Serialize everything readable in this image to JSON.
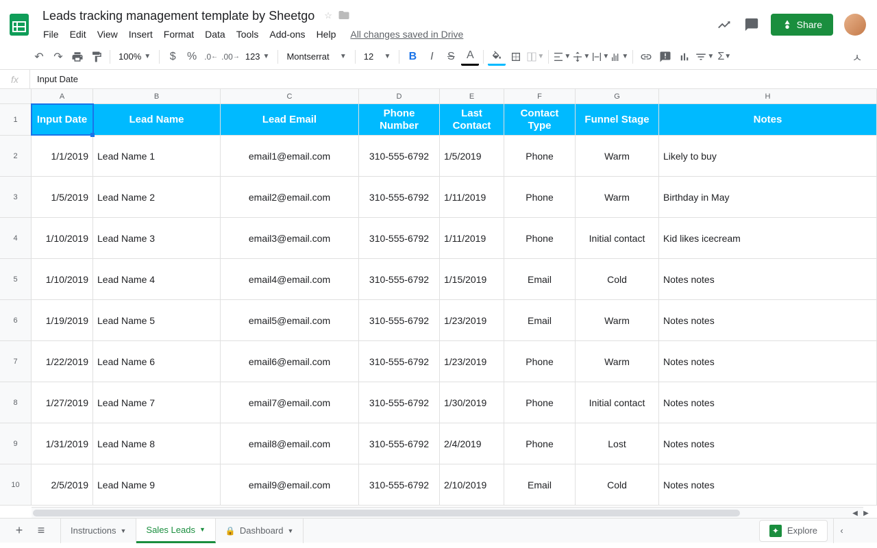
{
  "doc": {
    "title": "Leads tracking management template by Sheetgo",
    "save_status": "All changes saved in Drive"
  },
  "menu": {
    "file": "File",
    "edit": "Edit",
    "view": "View",
    "insert": "Insert",
    "format": "Format",
    "data": "Data",
    "tools": "Tools",
    "addons": "Add-ons",
    "help": "Help"
  },
  "header": {
    "share": "Share"
  },
  "toolbar": {
    "zoom": "100%",
    "dollar": "$",
    "percent": "%",
    "number_format": "123",
    "font": "Montserrat",
    "font_size": "12"
  },
  "formula": {
    "fx": "fx",
    "value": "Input Date"
  },
  "columns": [
    "A",
    "B",
    "C",
    "D",
    "E",
    "F",
    "G",
    "H"
  ],
  "sheet_headers": {
    "A": "Input Date",
    "B": "Lead Name",
    "C": "Lead Email",
    "D": "Phone Number",
    "E": "Last Contact",
    "F": "Contact Type",
    "G": "Funnel Stage",
    "H": "Notes"
  },
  "rows": [
    {
      "n": "2",
      "A": "1/1/2019",
      "B": "Lead Name 1",
      "C": "email1@email.com",
      "D": "310-555-6792",
      "E": "1/5/2019",
      "F": "Phone",
      "G": "Warm",
      "H": "Likely to buy"
    },
    {
      "n": "3",
      "A": "1/5/2019",
      "B": "Lead Name 2",
      "C": "email2@email.com",
      "D": "310-555-6792",
      "E": "1/11/2019",
      "F": "Phone",
      "G": "Warm",
      "H": "Birthday in May"
    },
    {
      "n": "4",
      "A": "1/10/2019",
      "B": "Lead Name 3",
      "C": "email3@email.com",
      "D": "310-555-6792",
      "E": "1/11/2019",
      "F": "Phone",
      "G": "Initial contact",
      "H": "Kid likes icecream"
    },
    {
      "n": "5",
      "A": "1/10/2019",
      "B": "Lead Name 4",
      "C": "email4@email.com",
      "D": "310-555-6792",
      "E": "1/15/2019",
      "F": "Email",
      "G": "Cold",
      "H": "Notes notes"
    },
    {
      "n": "6",
      "A": "1/19/2019",
      "B": "Lead Name 5",
      "C": "email5@email.com",
      "D": "310-555-6792",
      "E": "1/23/2019",
      "F": "Email",
      "G": "Warm",
      "H": "Notes notes"
    },
    {
      "n": "7",
      "A": "1/22/2019",
      "B": "Lead Name 6",
      "C": "email6@email.com",
      "D": "310-555-6792",
      "E": "1/23/2019",
      "F": "Phone",
      "G": "Warm",
      "H": "Notes notes"
    },
    {
      "n": "8",
      "A": "1/27/2019",
      "B": "Lead Name 7",
      "C": "email7@email.com",
      "D": "310-555-6792",
      "E": "1/30/2019",
      "F": "Phone",
      "G": "Initial contact",
      "H": "Notes notes"
    },
    {
      "n": "9",
      "A": "1/31/2019",
      "B": "Lead Name 8",
      "C": "email8@email.com",
      "D": "310-555-6792",
      "E": "2/4/2019",
      "F": "Phone",
      "G": "Lost",
      "H": "Notes notes"
    },
    {
      "n": "10",
      "A": "2/5/2019",
      "B": "Lead Name 9",
      "C": "email9@email.com",
      "D": "310-555-6792",
      "E": "2/10/2019",
      "F": "Email",
      "G": "Cold",
      "H": "Notes notes"
    }
  ],
  "tabs": {
    "instructions": "Instructions",
    "sales_leads": "Sales Leads",
    "dashboard": "Dashboard",
    "explore": "Explore"
  }
}
